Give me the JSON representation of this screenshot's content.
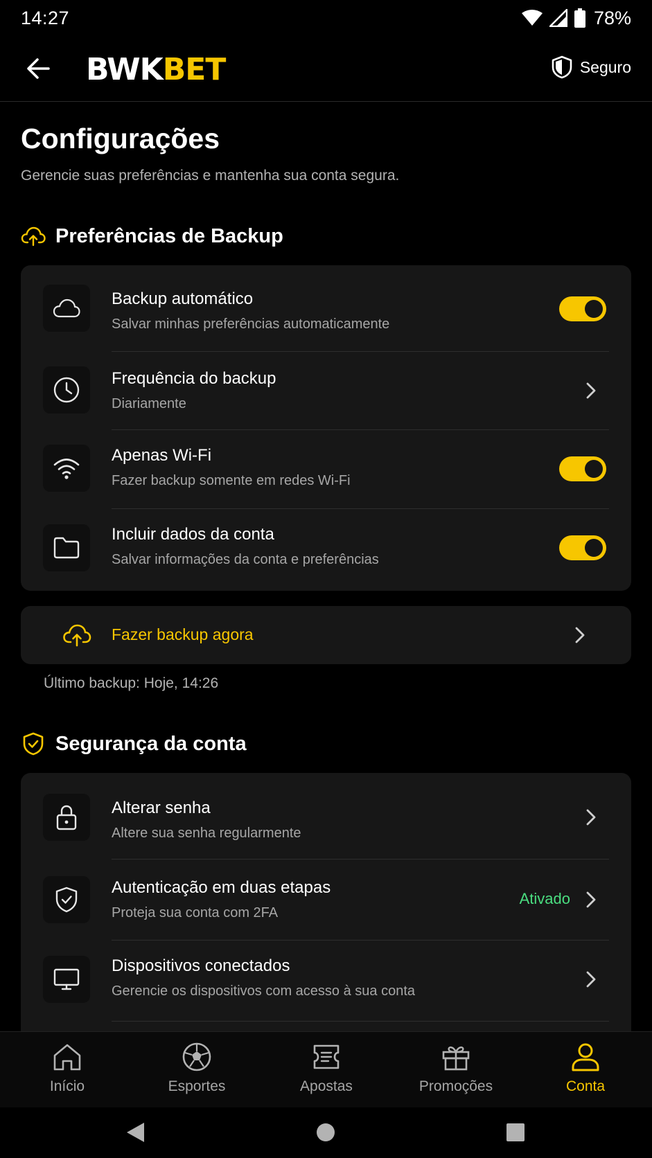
{
  "status_bar": {
    "time": "14:27",
    "battery": "78%"
  },
  "header": {
    "logo_part1": "BWK",
    "logo_part2": "BET",
    "secure_label": "Seguro"
  },
  "page": {
    "title": "Configurações",
    "subtitle": "Gerencie suas preferências e mantenha sua conta segura."
  },
  "backup": {
    "section_title": "Preferências de Backup",
    "items": [
      {
        "title": "Backup automático",
        "subtitle": "Salvar minhas preferências automaticamente",
        "icon": "cloud-icon",
        "control": "toggle",
        "enabled": true
      },
      {
        "title": "Frequência do backup",
        "subtitle": "Diariamente",
        "icon": "clock-icon",
        "control": "chevron"
      },
      {
        "title": "Apenas Wi-Fi",
        "subtitle": "Fazer backup somente em redes Wi-Fi",
        "icon": "wifi-icon",
        "control": "toggle",
        "enabled": true
      },
      {
        "title": "Incluir dados da conta",
        "subtitle": "Salvar informações da conta e preferências",
        "icon": "folder-icon",
        "control": "toggle",
        "enabled": true
      }
    ],
    "backup_now_label": "Fazer backup agora",
    "last_backup": "Último backup: Hoje, 14:26"
  },
  "security": {
    "section_title": "Segurança da conta",
    "items": [
      {
        "title": "Alterar senha",
        "subtitle": "Altere sua senha regularmente",
        "icon": "lock-icon"
      },
      {
        "title": "Autenticação em duas etapas",
        "subtitle": "Proteja sua conta com 2FA",
        "icon": "shield-check-icon",
        "status": "Ativado"
      },
      {
        "title": "Dispositivos conectados",
        "subtitle": "Gerencie os dispositivos com acesso à sua conta",
        "icon": "monitor-icon"
      }
    ]
  },
  "bottom_nav": {
    "items": [
      {
        "label": "Início",
        "icon": "home-icon"
      },
      {
        "label": "Esportes",
        "icon": "soccer-ball-icon"
      },
      {
        "label": "Apostas",
        "icon": "ticket-icon"
      },
      {
        "label": "Promoções",
        "icon": "gift-icon"
      },
      {
        "label": "Conta",
        "icon": "user-icon",
        "active": true
      }
    ]
  },
  "colors": {
    "accent": "#F7C600",
    "background": "#000000",
    "card": "#171717",
    "success": "#4ADE80"
  }
}
